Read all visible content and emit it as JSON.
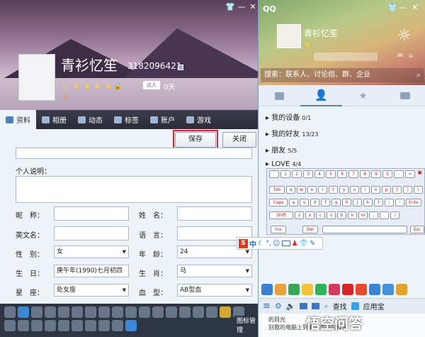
{
  "profile": {
    "nickname": "青衫忆笙",
    "qq_number": "3182096421",
    "days": "0天",
    "tabs": [
      {
        "label": "资料",
        "active": true
      },
      {
        "label": "相册"
      },
      {
        "label": "动态"
      },
      {
        "label": "标签"
      },
      {
        "label": "账户"
      },
      {
        "label": "游戏"
      }
    ],
    "save_label": "保存",
    "close_label": "关闭",
    "personal_desc_label": "个人说明：",
    "fields": {
      "nickname_label": "昵　称：",
      "name_label": "姓　名：",
      "english_label": "英文名：",
      "language_label": "语　言：",
      "gender_label": "性　别：",
      "gender_value": "女",
      "age_label": "年　龄：",
      "age_value": "24",
      "birthday_label": "生　日：",
      "birthday_value": "庚午年(1990)七月初四",
      "zodiac_label": "生　肖：",
      "zodiac_value": "马",
      "star_label": "星　座：",
      "star_value": "处女座",
      "blood_label": "血　型：",
      "blood_value": "AB型血"
    },
    "icon_manage": "图标管理"
  },
  "qq": {
    "title": "QQ",
    "nickname": "青衫忆笙",
    "search_placeholder": "搜索：联系人、讨论组、群、企业",
    "groups": [
      {
        "name": "我的设备",
        "count": "0/1"
      },
      {
        "name": "我的好友",
        "count": "13/23"
      },
      {
        "name": "朋友",
        "count": "5/5"
      },
      {
        "name": "LOVE",
        "count": "4/4"
      }
    ],
    "bottom": {
      "search": "查找",
      "app_center": "应用宝"
    },
    "news_title": "的目光",
    "news_text": "别我的电脑上到第三步的时候是"
  },
  "keyboard": {
    "row1": [
      "`",
      "1",
      "2",
      "3",
      "4",
      "5",
      "6",
      "7",
      "8",
      "9",
      "0",
      "-",
      "=",
      "←"
    ],
    "row2": [
      "Tab",
      "q",
      "w",
      "e",
      "r",
      "t",
      "y",
      "u",
      "i",
      "o",
      "p",
      "[",
      "]",
      "\\"
    ],
    "row3": [
      "Caps",
      "a",
      "s",
      "d",
      "f",
      "g",
      "h",
      "j",
      "k",
      "l",
      ";",
      "'",
      "Ente"
    ],
    "row4": [
      "Shift",
      "z",
      "x",
      "c",
      "v",
      "b",
      "n",
      "m",
      ",",
      ".",
      "/"
    ],
    "ins": "Ins",
    "del": "Del",
    "esc": "Esc"
  },
  "ime": {
    "label": "中"
  },
  "watermark": "悟空问答"
}
